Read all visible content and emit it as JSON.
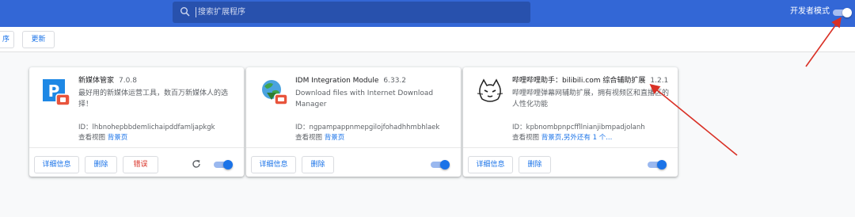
{
  "header": {
    "search_placeholder": "搜索扩展程序",
    "dev_mode_label": "开发者模式",
    "dev_mode_on": true
  },
  "toolbar": {
    "left_partial_label": "序",
    "update_label": "更新"
  },
  "cards": [
    {
      "name": "新媒体管家",
      "version": "7.0.8",
      "description": "最好用的新媒体运营工具，数百万新媒体人的选择！",
      "id_text": "ID：lhbnohepbbdemlichaipddfamljapkgk",
      "views_label": "查看视图",
      "views_link": "背景页",
      "details_label": "详细信息",
      "remove_label": "删除",
      "errors_label": "错误",
      "enabled": true,
      "icon": "p-media-icon"
    },
    {
      "name": "IDM Integration Module",
      "version": "6.33.2",
      "description": "Download files with Internet Download Manager",
      "id_text": "ID：ngpampappnmepgilojfohadhhmbhlaek",
      "views_label": "查看视图",
      "views_link": "背景页",
      "details_label": "详细信息",
      "remove_label": "删除",
      "enabled": true,
      "icon": "idm-globe-icon"
    },
    {
      "name": "哔哩哔哩助手：bilibili.com 综合辅助扩展",
      "version": "1.2.1",
      "description": "哔哩哔哩弹幕网辅助扩展，拥有视频区和直播区的人性化功能",
      "id_text": "ID：kpbnombpnpcffllnianjibmpadjolanh",
      "views_label": "查看视图",
      "views_link": "背景页,另外还有 1 个...",
      "details_label": "详细信息",
      "remove_label": "删除",
      "enabled": true,
      "icon": "bilibili-cat-icon"
    }
  ],
  "colors": {
    "header_bg": "#3367d6",
    "accent": "#1a73e8",
    "error": "#d93025",
    "annotation_arrow": "#d93025"
  }
}
